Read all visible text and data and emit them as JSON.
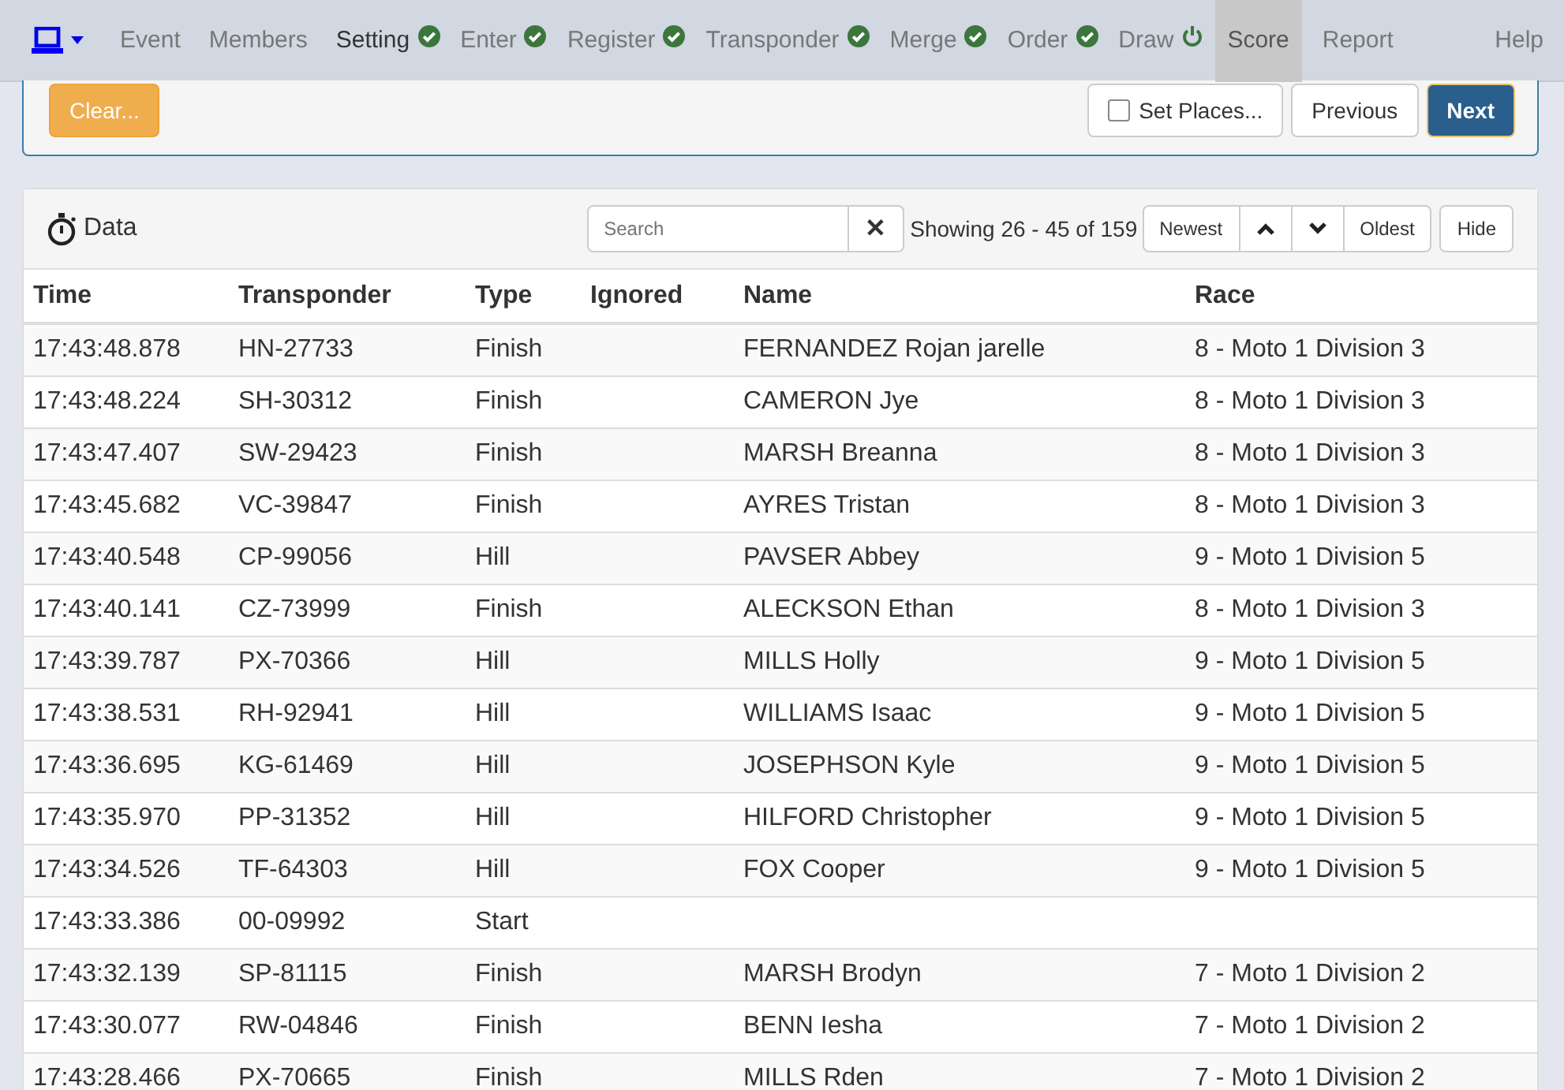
{
  "nav": {
    "items": [
      {
        "label": "Event",
        "selected": false,
        "kind": "plain"
      },
      {
        "label": "Members",
        "selected": false,
        "kind": "plain"
      },
      {
        "label": "Setting",
        "selected": false,
        "hover": true,
        "kind": "done"
      },
      {
        "label": "Enter",
        "selected": false,
        "kind": "done"
      },
      {
        "label": "Register",
        "selected": false,
        "kind": "done"
      },
      {
        "label": "Transponder",
        "selected": false,
        "kind": "done"
      },
      {
        "label": "Merge",
        "selected": false,
        "kind": "done"
      },
      {
        "label": "Order",
        "selected": false,
        "kind": "done"
      },
      {
        "label": "Draw",
        "selected": false,
        "kind": "power"
      },
      {
        "label": "Score",
        "selected": true,
        "kind": "plain"
      },
      {
        "label": "Report",
        "selected": false,
        "kind": "plain"
      }
    ],
    "help": "Help"
  },
  "toolbar": {
    "clear": "Clear...",
    "set_places": {
      "label": "Set Places...",
      "checked": false
    },
    "previous": "Previous",
    "next": "Next"
  },
  "data_panel": {
    "title": "Data",
    "search": {
      "placeholder": "Search"
    },
    "clear_search": "✕",
    "showing": "Showing 26 - 45 of 159",
    "buttons": {
      "newest": "Newest",
      "oldest": "Oldest",
      "hide": "Hide"
    }
  },
  "table": {
    "columns": [
      "Time",
      "Transponder",
      "Type",
      "Ignored",
      "Name",
      "Race"
    ],
    "rows": [
      [
        "17:43:48.878",
        "HN-27733",
        "Finish",
        "",
        "FERNANDEZ Rojan jarelle",
        "8 - Moto 1 Division 3"
      ],
      [
        "17:43:48.224",
        "SH-30312",
        "Finish",
        "",
        "CAMERON Jye",
        "8 - Moto 1 Division 3"
      ],
      [
        "17:43:47.407",
        "SW-29423",
        "Finish",
        "",
        "MARSH Breanna",
        "8 - Moto 1 Division 3"
      ],
      [
        "17:43:45.682",
        "VC-39847",
        "Finish",
        "",
        "AYRES Tristan",
        "8 - Moto 1 Division 3"
      ],
      [
        "17:43:40.548",
        "CP-99056",
        "Hill",
        "",
        "PAVSER Abbey",
        "9 - Moto 1 Division 5"
      ],
      [
        "17:43:40.141",
        "CZ-73999",
        "Finish",
        "",
        "ALECKSON Ethan",
        "8 - Moto 1 Division 3"
      ],
      [
        "17:43:39.787",
        "PX-70366",
        "Hill",
        "",
        "MILLS Holly",
        "9 - Moto 1 Division 5"
      ],
      [
        "17:43:38.531",
        "RH-92941",
        "Hill",
        "",
        "WILLIAMS Isaac",
        "9 - Moto 1 Division 5"
      ],
      [
        "17:43:36.695",
        "KG-61469",
        "Hill",
        "",
        "JOSEPHSON Kyle",
        "9 - Moto 1 Division 5"
      ],
      [
        "17:43:35.970",
        "PP-31352",
        "Hill",
        "",
        "HILFORD Christopher",
        "9 - Moto 1 Division 5"
      ],
      [
        "17:43:34.526",
        "TF-64303",
        "Hill",
        "",
        "FOX Cooper",
        "9 - Moto 1 Division 5"
      ],
      [
        "17:43:33.386",
        "00-09992",
        "Start",
        "",
        "",
        ""
      ],
      [
        "17:43:32.139",
        "SP-81115",
        "Finish",
        "",
        "MARSH Brodyn",
        "7 - Moto 1 Division 2"
      ],
      [
        "17:43:30.077",
        "RW-04846",
        "Finish",
        "",
        "BENN Iesha",
        "7 - Moto 1 Division 2"
      ],
      [
        "17:43:28.466",
        "PX-70665",
        "Finish",
        "",
        "MILLS Rden",
        "7 - Moto 1 Division 2"
      ]
    ]
  }
}
